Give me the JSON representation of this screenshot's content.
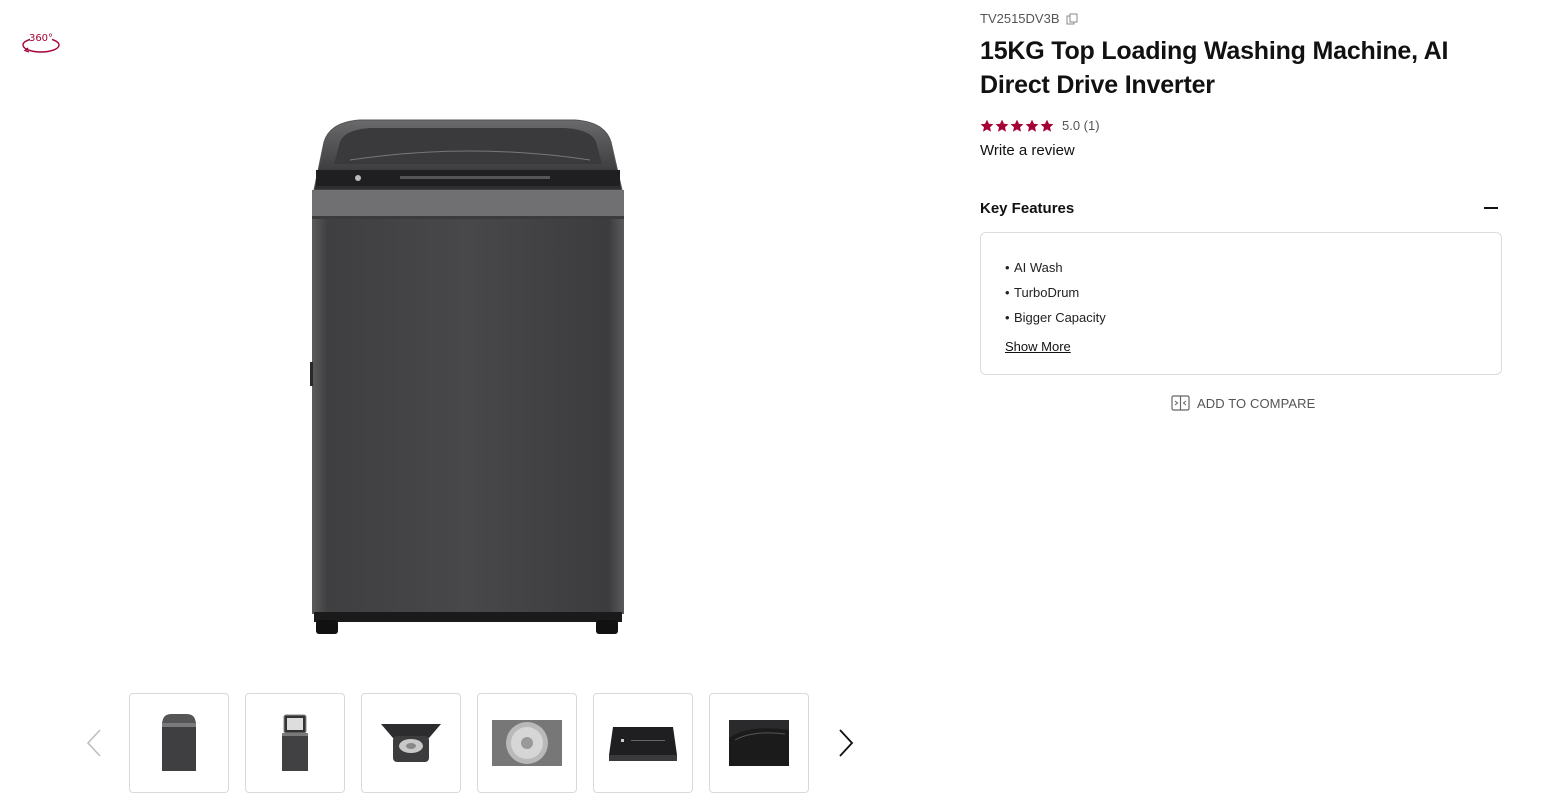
{
  "product": {
    "sku": "TV2515DV3B",
    "title": "15KG Top Loading Washing Machine, AI Direct Drive Inverter",
    "rating": {
      "stars": 5,
      "score_text": "5.0 (1)",
      "star_color": "#a50034"
    },
    "write_review": "Write a review"
  },
  "viewer": {
    "badge_360": "360°",
    "badge_color": "#a50034"
  },
  "gallery": {
    "thumbnails": [
      {
        "name": "front-closed"
      },
      {
        "name": "front-lid-open"
      },
      {
        "name": "top-open-drum"
      },
      {
        "name": "drum-interior"
      },
      {
        "name": "control-panel"
      },
      {
        "name": "angle-top"
      }
    ]
  },
  "key_features": {
    "title": "Key Features",
    "items": [
      "AI Wash",
      "TurboDrum",
      "Bigger Capacity"
    ],
    "show_more": "Show More"
  },
  "compare": {
    "label": "ADD TO COMPARE"
  }
}
